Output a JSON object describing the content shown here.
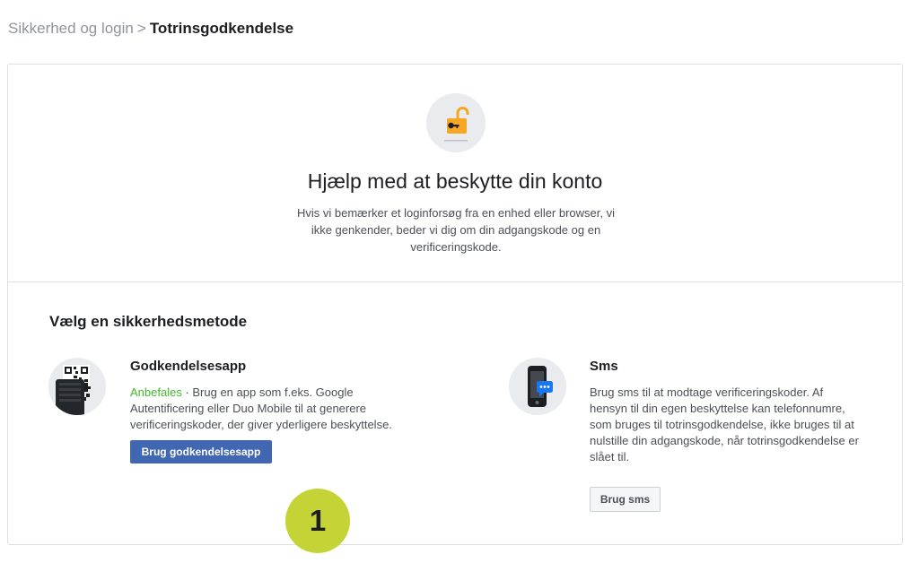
{
  "breadcrumb": {
    "parent": "Sikkerhed og login",
    "separator": ">",
    "current": "Totrinsgodkendelse"
  },
  "hero": {
    "icon": "unlocked-padlock-key-icon",
    "title": "Hjælp med at beskytte din konto",
    "description": "Hvis vi bemærker et loginforsøg fra en enhed eller browser, vi ikke genkender, beder vi dig om din adgangskode og en verificeringskode."
  },
  "methods": {
    "section_title": "Vælg en sikkerhedsmetode",
    "auth_app": {
      "icon": "qr-code-phone-icon",
      "title": "Godkendelsesapp",
      "badge": "Anbefales",
      "description": " · Brug en app som f.eks. Google Autentificering eller Duo Mobile til at generere verificeringskoder, der giver yderligere beskyttelse.",
      "button_label": "Brug godkendelsesapp"
    },
    "sms": {
      "icon": "phone-message-icon",
      "title": "Sms",
      "description": "Brug sms til at modtage verificeringskoder. Af hensyn til din egen beskyttelse kan telefonnumre, som bruges til totrinsgodkendelse, ikke bruges til at nulstille din adgangskode, når totrinsgodkendelse er slået til.",
      "button_label": "Brug sms"
    }
  },
  "annotation": {
    "step_number": "1",
    "color": "#c4d436"
  },
  "colors": {
    "primary": "#4267b2",
    "recommended": "#42b72a",
    "lock": "#f5a623"
  }
}
